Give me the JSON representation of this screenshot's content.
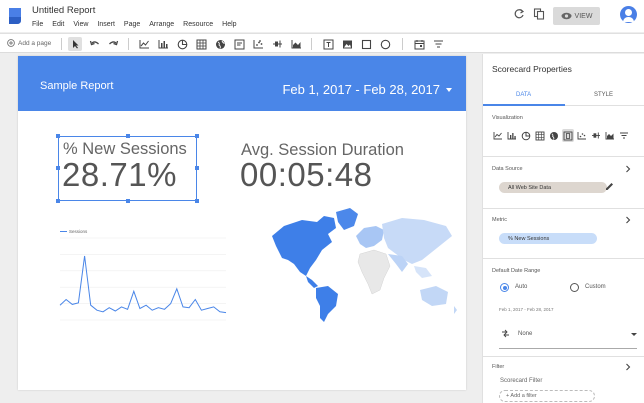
{
  "app": {
    "title": "Untitled Report",
    "menu": [
      "File",
      "Edit",
      "View",
      "Insert",
      "Page",
      "Arrange",
      "Resource",
      "Help"
    ],
    "view_label": "VIEW",
    "brand_color": "#4a86e8"
  },
  "toolbar": {
    "add_page_label": "Add a page"
  },
  "report": {
    "title": "Sample Report",
    "date_range": "Feb 1, 2017 - Feb 28, 2017",
    "scorecards": [
      {
        "label": "% New Sessions",
        "value": "28.71%"
      },
      {
        "label": "Avg. Session Duration",
        "value": "00:05:48"
      }
    ],
    "legend_series": "Sessions"
  },
  "chart_data": {
    "type": "line",
    "title": "",
    "series": [
      {
        "name": "Sessions",
        "values": [
          18,
          25,
          19,
          21,
          78,
          18,
          12,
          10,
          15,
          11,
          16,
          13,
          35,
          14,
          18,
          12,
          15,
          13,
          20,
          38,
          16,
          15,
          25,
          12,
          14,
          16,
          10,
          9
        ]
      }
    ],
    "ylim": [
      0,
      100
    ],
    "grid": true,
    "legend": "top-left"
  },
  "panel": {
    "title": "Scorecard Properties",
    "tabs": [
      "DATA",
      "STYLE"
    ],
    "visualization_label": "Visualization",
    "data_source_label": "Data Source",
    "data_source_value": "All Web Site Data",
    "metric_label": "Metric",
    "metric_value": "% New Sessions",
    "date_range_label": "Default Date Range",
    "auto_label": "Auto",
    "custom_label": "Custom",
    "auto_range_text": "Feb 1, 2017 - Feb 28, 2017",
    "comparison_value": "None",
    "filter_label": "Filter",
    "scorecard_filter_label": "Scorecard Filter",
    "add_filter_label": "+ Add a filter"
  }
}
